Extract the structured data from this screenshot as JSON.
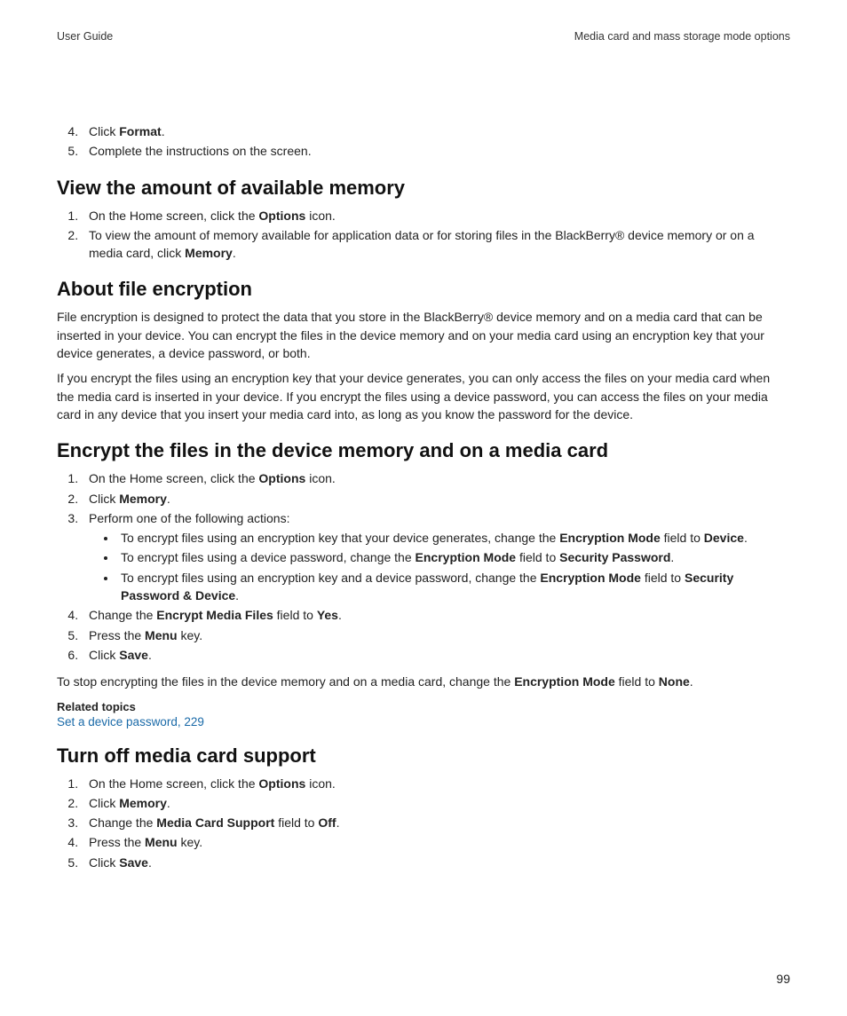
{
  "header": {
    "left": "User Guide",
    "right": "Media card and mass storage mode options"
  },
  "intro_list": {
    "start": 4,
    "items": [
      {
        "pre": "Click ",
        "b1": "Format",
        "post": "."
      },
      {
        "pre": "Complete the instructions on the screen.",
        "b1": "",
        "post": ""
      }
    ]
  },
  "s1": {
    "title": "View the amount of available memory",
    "items": [
      {
        "pre": "On the Home screen, click the ",
        "b1": "Options",
        "post": " icon."
      },
      {
        "pre": "To view the amount of memory available for application data or for storing files in the BlackBerry® device memory or on a media card, click ",
        "b1": "Memory",
        "post": "."
      }
    ]
  },
  "s2": {
    "title": "About file encryption",
    "p1": "File encryption is designed to protect the data that you store in the BlackBerry® device memory and on a media card that can be inserted in your device. You can encrypt the files in the device memory and on your media card using an encryption key that your device generates, a device password, or both.",
    "p2": "If you encrypt the files using an encryption key that your device generates, you can only access the files on your media card when the media card is inserted in your device. If you encrypt the files using a device password, you can access the files on your media card in any device that you insert your media card into, as long as you know the password for the device."
  },
  "s3": {
    "title": "Encrypt the files in the device memory and on a media card",
    "i1": {
      "pre": "On the Home screen, click the ",
      "b1": "Options",
      "post": " icon."
    },
    "i2": {
      "pre": "Click ",
      "b1": "Memory",
      "post": "."
    },
    "i3": {
      "pre": "Perform one of the following actions:"
    },
    "bullets": [
      {
        "pre": "To encrypt files using an encryption key that your device generates, change the ",
        "b1": "Encryption Mode",
        "mid": " field to ",
        "b2": "Device",
        "post": "."
      },
      {
        "pre": "To encrypt files using a device password, change the ",
        "b1": "Encryption Mode",
        "mid": " field to ",
        "b2": "Security Password",
        "post": "."
      },
      {
        "pre": "To encrypt files using an encryption key and a device password, change the ",
        "b1": "Encryption Mode",
        "mid": " field to ",
        "b2": "Security Password & Device",
        "post": "."
      }
    ],
    "i4": {
      "pre": "Change the ",
      "b1": "Encrypt Media Files",
      "mid": " field to ",
      "b2": "Yes",
      "post": "."
    },
    "i5": {
      "pre": "Press the ",
      "b1": "Menu",
      "post": " key."
    },
    "i6": {
      "pre": "Click ",
      "b1": "Save",
      "post": "."
    },
    "foot": {
      "pre": "To stop encrypting the files in the device memory and on a media card, change the ",
      "b1": "Encryption Mode",
      "mid": " field to ",
      "b2": "None",
      "post": "."
    },
    "rel_title": "Related topics",
    "rel_link": "Set a device password, 229"
  },
  "s4": {
    "title": "Turn off media card support",
    "i1": {
      "pre": "On the Home screen, click the ",
      "b1": "Options",
      "post": " icon."
    },
    "i2": {
      "pre": "Click ",
      "b1": "Memory",
      "post": "."
    },
    "i3": {
      "pre": "Change the ",
      "b1": "Media Card Support",
      "mid": " field to ",
      "b2": "Off",
      "post": "."
    },
    "i4": {
      "pre": "Press the ",
      "b1": "Menu",
      "post": " key."
    },
    "i5": {
      "pre": "Click ",
      "b1": "Save",
      "post": "."
    }
  },
  "page_number": "99"
}
